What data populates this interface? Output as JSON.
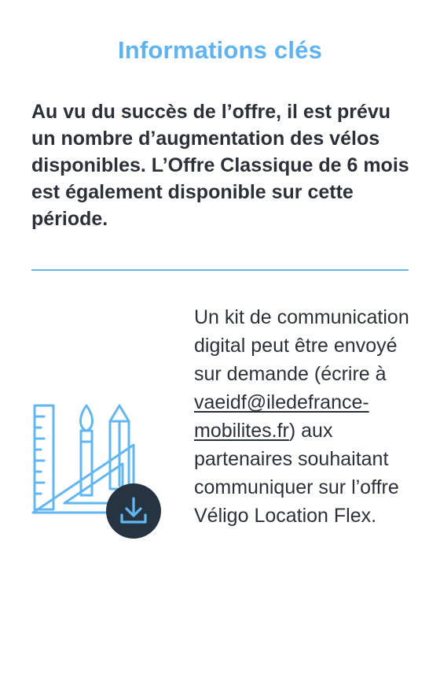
{
  "section": {
    "title": "Informations clés",
    "key_info": "Au vu du succès de l’offre, il est prévu un nombre d’augmentation des vélos disponibles. L’Offre Classique de 6 mois est également disponible sur cette période."
  },
  "kit": {
    "text_before": "Un kit de communication digital peut être envoyé sur demande (écrire à ",
    "email_link": "vaeidf@iledefrance-mobilites.fr",
    "text_after": ") aux partenaires souhaitant communiquer sur l’offre Véligo Location Flex."
  },
  "colors": {
    "accent": "#5fb3f0",
    "text": "#2c3038",
    "download_badge": "#263340"
  },
  "icons": {
    "illustration": "drawing-tools-icon",
    "download": "download-icon"
  }
}
